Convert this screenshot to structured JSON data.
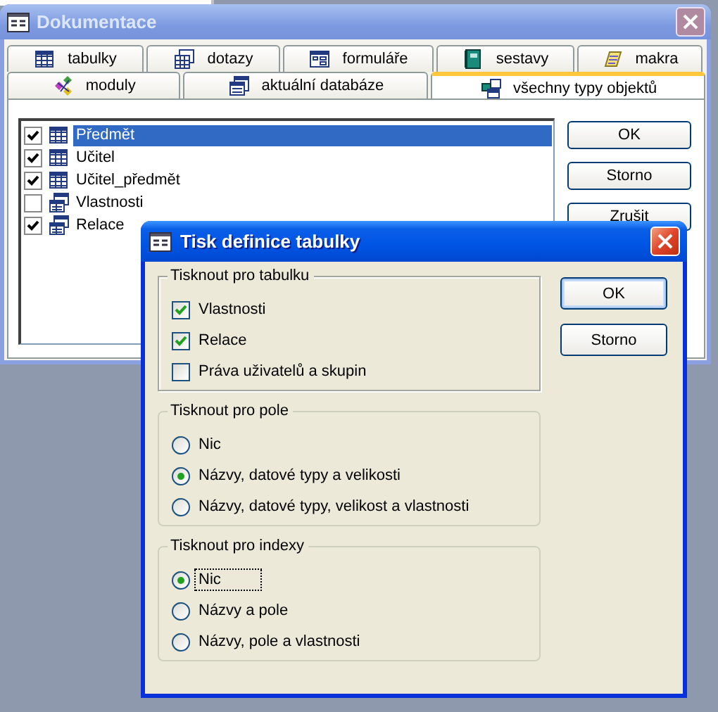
{
  "background_window": {
    "title": "Dokumentace",
    "tab_rows": [
      {
        "tabs": [
          {
            "label": "tabulky",
            "kind": "table",
            "selected": false
          },
          {
            "label": "dotazy",
            "kind": "query",
            "selected": false
          },
          {
            "label": "formuláře",
            "kind": "form",
            "selected": false
          },
          {
            "label": "sestavy",
            "kind": "report",
            "selected": false
          },
          {
            "label": "makra",
            "kind": "macro",
            "selected": false
          }
        ]
      },
      {
        "tabs": [
          {
            "label": "moduly",
            "kind": "module",
            "selected": false
          },
          {
            "label": "aktuální databáze",
            "kind": "database",
            "selected": false
          },
          {
            "label": "všechny typy objektů",
            "kind": "all",
            "selected": true
          }
        ]
      }
    ],
    "objects": [
      {
        "name": "Předmět",
        "kind": "table",
        "checked": true,
        "selected": true
      },
      {
        "name": "Učitel",
        "kind": "table",
        "checked": true,
        "selected": false
      },
      {
        "name": "Učitel_předmět",
        "kind": "table",
        "checked": true,
        "selected": false
      },
      {
        "name": "Vlastnosti",
        "kind": "relation",
        "checked": false,
        "selected": false
      },
      {
        "name": "Relace",
        "kind": "relation",
        "checked": true,
        "selected": false
      }
    ],
    "buttons": [
      "OK",
      "Storno",
      "Zrušit"
    ]
  },
  "dialog": {
    "title": "Tisk definice tabulky",
    "groups": [
      {
        "title": "Tisknout pro tabulku",
        "kind": "checkboxes",
        "options": [
          {
            "label": "Vlastnosti",
            "checked": true,
            "focused": false
          },
          {
            "label": "Relace",
            "checked": true,
            "focused": false
          },
          {
            "label": "Práva uživatelů a skupin",
            "checked": false,
            "focused": false
          }
        ]
      },
      {
        "title": "Tisknout pro pole",
        "kind": "radios",
        "options": [
          {
            "label": "Nic",
            "selected": false,
            "focused": false
          },
          {
            "label": "Názvy, datové typy a velikosti",
            "selected": true,
            "focused": false
          },
          {
            "label": "Názvy, datové typy, velikost a vlastnosti",
            "selected": false,
            "focused": false
          }
        ]
      },
      {
        "title": "Tisknout pro indexy",
        "kind": "radios",
        "options": [
          {
            "label": "Nic",
            "selected": true,
            "focused": true
          },
          {
            "label": "Názvy a pole",
            "selected": false,
            "focused": false
          },
          {
            "label": "Názvy, pole a vlastnosti",
            "selected": false,
            "focused": false
          }
        ]
      }
    ],
    "buttons": [
      "OK",
      "Storno"
    ]
  }
}
